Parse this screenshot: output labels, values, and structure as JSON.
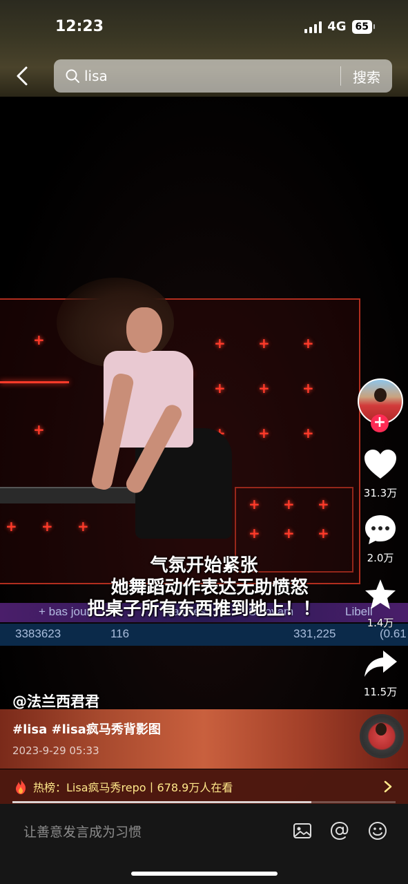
{
  "status_bar": {
    "time": "12:23",
    "network": "4G",
    "battery": "65"
  },
  "search": {
    "query": "lisa",
    "button_label": "搜索"
  },
  "video": {
    "subtitles": [
      "气氛开始紧张",
      "她舞蹈动作表达无助愤怒",
      "把桌子所有东西推到地上！！"
    ],
    "screen_texts": [
      "331,225",
      "Libell",
      "Sicovam",
      "Vallines",
      "(0.61",
      "3383623",
      "116",
      "+ bas jour"
    ]
  },
  "actions": {
    "likes": "31.3万",
    "comments": "2.0万",
    "favorites": "1.4万",
    "shares": "11.5万"
  },
  "post": {
    "author": "@法兰西君君",
    "hashtags": "#lisa #lisa疯马秀背影图",
    "date": "2023-9-29 05:33"
  },
  "hot": {
    "text": "热榜：Lisa疯马秀repo丨678.9万人在看"
  },
  "progress": {
    "fraction": 0.78
  },
  "comment": {
    "placeholder": "让善意发言成为习惯"
  },
  "colors": {
    "accent": "#fe2c55",
    "hot_text": "#ffe88a",
    "stage_red": "#ff3b2a"
  }
}
